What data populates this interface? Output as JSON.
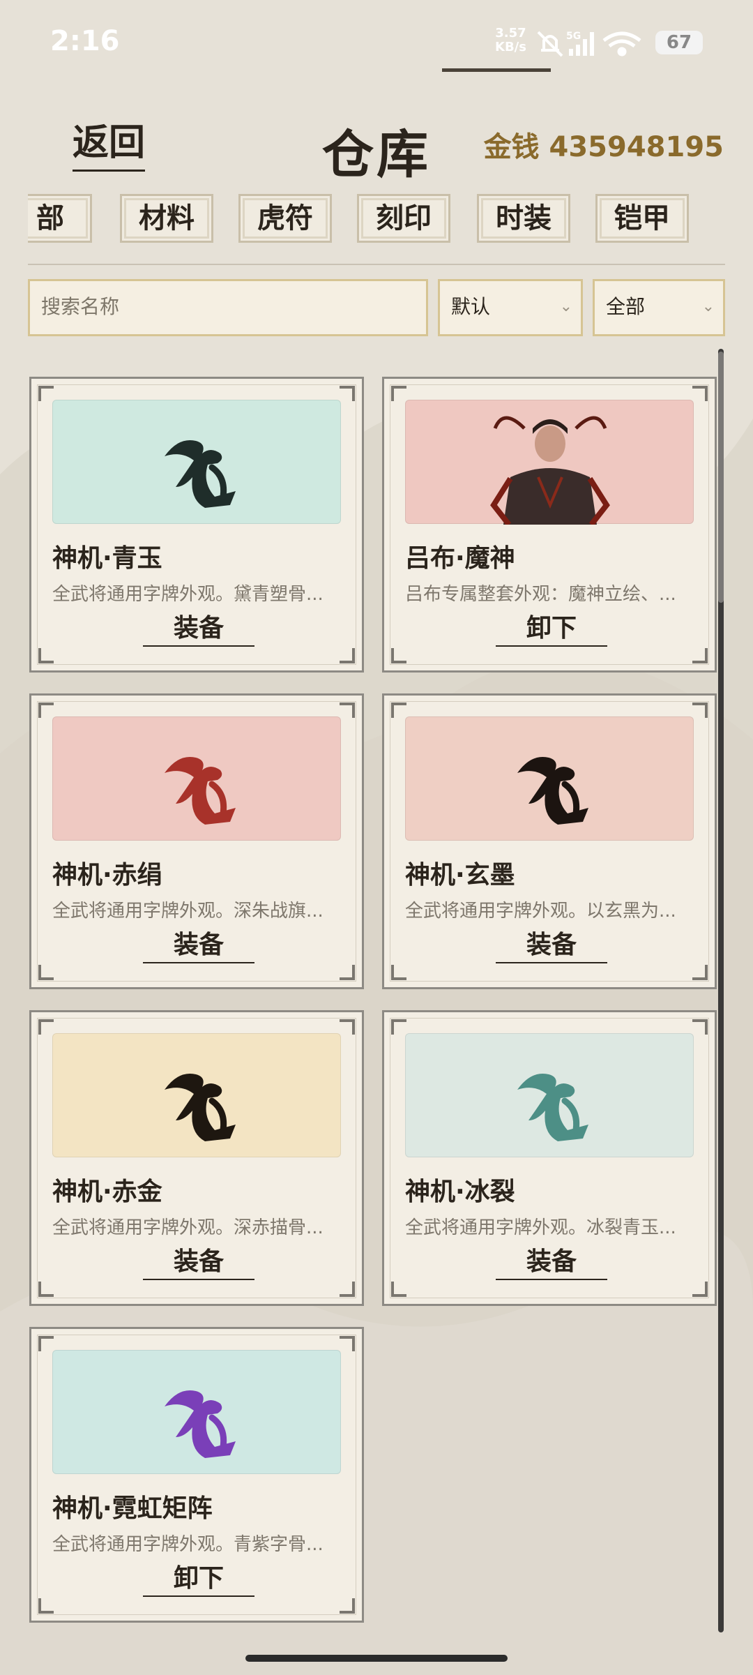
{
  "status": {
    "time": "2:16",
    "net_speed": "3.57",
    "net_unit": "KB/s",
    "signal": "5G",
    "battery": "67"
  },
  "header": {
    "back_label": "返回",
    "title": "仓库",
    "gold_label": "金钱",
    "gold_value": "435948195"
  },
  "tabs": [
    {
      "label": "部",
      "active": false
    },
    {
      "label": "材料",
      "active": false
    },
    {
      "label": "虎符",
      "active": false
    },
    {
      "label": "刻印",
      "active": false
    },
    {
      "label": "时装",
      "active": true
    },
    {
      "label": "铠甲",
      "active": false
    }
  ],
  "search": {
    "placeholder": "搜索名称"
  },
  "filters": {
    "sort_value": "默认",
    "type_value": "全部"
  },
  "items": [
    {
      "name": "神机·青玉",
      "desc": "全武将通用字牌外观。黛青塑骨...",
      "action": "装备",
      "thumb_bg": "#cfe9e0",
      "glyph_color": "#1f2d2a",
      "icon": "fei-glyph-icon"
    },
    {
      "name": "吕布·魔神",
      "desc": "吕布专属整套外观：魔神立绘、...",
      "action": "卸下",
      "thumb_bg": "#efc8c1",
      "glyph_color": "#2a2020",
      "icon": "warrior-portrait-icon"
    },
    {
      "name": "神机·赤绢",
      "desc": "全武将通用字牌外观。深朱战旗...",
      "action": "装备",
      "thumb_bg": "#efc9c2",
      "glyph_color": "#a8322a",
      "icon": "fei-glyph-icon"
    },
    {
      "name": "神机·玄墨",
      "desc": "全武将通用字牌外观。以玄黑为...",
      "action": "装备",
      "thumb_bg": "#efcfc4",
      "glyph_color": "#1c1410",
      "icon": "fei-glyph-icon"
    },
    {
      "name": "神机·赤金",
      "desc": "全武将通用字牌外观。深赤描骨...",
      "action": "装备",
      "thumb_bg": "#f3e4c3",
      "glyph_color": "#1e1710",
      "icon": "fei-glyph-icon"
    },
    {
      "name": "神机·冰裂",
      "desc": "全武将通用字牌外观。冰裂青玉...",
      "action": "装备",
      "thumb_bg": "#dde8e2",
      "glyph_color": "#4d8f86",
      "icon": "fei-glyph-icon"
    },
    {
      "name": "神机·霓虹矩阵",
      "desc": "全武将通用字牌外观。青紫字骨...",
      "action": "卸下",
      "thumb_bg": "#cfe8e3",
      "glyph_color": "#7a3fb8",
      "icon": "fei-glyph-icon"
    }
  ]
}
